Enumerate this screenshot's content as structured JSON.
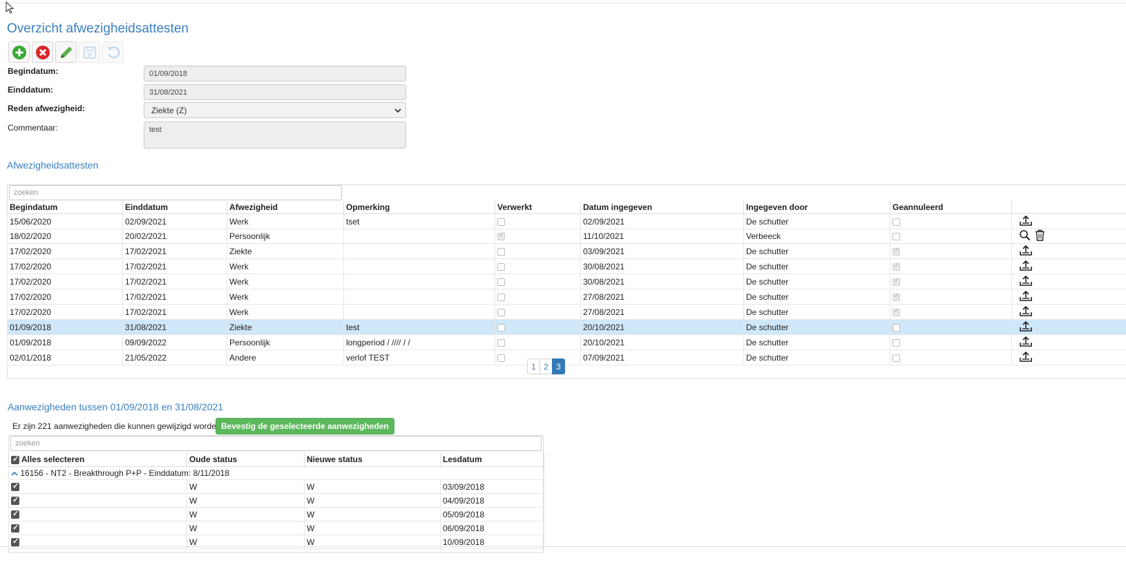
{
  "page": {
    "title": "Overzicht afwezigheidsattesten"
  },
  "toolbar": {
    "buttons": [
      "add-icon",
      "delete-icon",
      "edit-icon",
      "save-icon",
      "undo-icon"
    ]
  },
  "form": {
    "begindatum_label": "Begindatum:",
    "begindatum_value": "01/09/2018",
    "einddatum_label": "Einddatum:",
    "einddatum_value": "31/08/2021",
    "reden_label": "Reden afwezigheid:",
    "reden_value": "Ziekte (Z)",
    "commentaar_label": "Commentaar:",
    "commentaar_value": "test"
  },
  "attesten": {
    "heading": "Afwezigheidsattesten",
    "search_placeholder": "zoeken",
    "columns": [
      "Begindatum",
      "Einddatum",
      "Afwezigheid",
      "Opmerking",
      "Verwerkt",
      "Datum ingegeven",
      "Ingegeven door",
      "Geannuleerd"
    ],
    "rows": [
      {
        "begin": "15/06/2020",
        "eind": "02/09/2021",
        "afw": "Werk",
        "opm": "tset",
        "verwerkt": false,
        "datum": "02/09/2021",
        "door": "De schutter",
        "geannuleerd": false,
        "actions": [
          "upload-icon"
        ]
      },
      {
        "begin": "18/02/2020",
        "eind": "20/02/2021",
        "afw": "Persoonlijk",
        "opm": "",
        "verwerkt": true,
        "datum": "11/10/2021",
        "door": "Verbeeck",
        "geannuleerd": false,
        "actions": [
          "search-icon",
          "trash-icon"
        ]
      },
      {
        "begin": "17/02/2020",
        "eind": "17/02/2021",
        "afw": "Ziekte",
        "opm": "",
        "verwerkt": false,
        "datum": "03/09/2021",
        "door": "De schutter",
        "geannuleerd": true,
        "actions": [
          "upload-icon"
        ]
      },
      {
        "begin": "17/02/2020",
        "eind": "17/02/2021",
        "afw": "Werk",
        "opm": "",
        "verwerkt": false,
        "datum": "30/08/2021",
        "door": "De schutter",
        "geannuleerd": true,
        "actions": [
          "upload-icon"
        ]
      },
      {
        "begin": "17/02/2020",
        "eind": "17/02/2021",
        "afw": "Werk",
        "opm": "",
        "verwerkt": false,
        "datum": "30/08/2021",
        "door": "De schutter",
        "geannuleerd": true,
        "actions": [
          "upload-icon"
        ]
      },
      {
        "begin": "17/02/2020",
        "eind": "17/02/2021",
        "afw": "Werk",
        "opm": "",
        "verwerkt": false,
        "datum": "27/08/2021",
        "door": "De schutter",
        "geannuleerd": true,
        "actions": [
          "upload-icon"
        ]
      },
      {
        "begin": "17/02/2020",
        "eind": "17/02/2021",
        "afw": "Werk",
        "opm": "",
        "verwerkt": false,
        "datum": "27/08/2021",
        "door": "De schutter",
        "geannuleerd": true,
        "actions": [
          "upload-icon"
        ]
      },
      {
        "begin": "01/09/2018",
        "eind": "31/08/2021",
        "afw": "Ziekte",
        "opm": "test",
        "verwerkt": false,
        "datum": "20/10/2021",
        "door": "De schutter",
        "geannuleerd": false,
        "actions": [
          "upload-icon"
        ],
        "selected": true
      },
      {
        "begin": "01/09/2018",
        "eind": "09/09/2022",
        "afw": "Persoonlijk",
        "opm": "longperiod / //// / /",
        "verwerkt": false,
        "datum": "20/10/2021",
        "door": "De schutter",
        "geannuleerd": false,
        "actions": [
          "upload-icon"
        ]
      },
      {
        "begin": "02/01/2018",
        "eind": "21/05/2022",
        "afw": "Andere",
        "opm": "verlof TEST",
        "verwerkt": false,
        "datum": "07/09/2021",
        "door": "De schutter",
        "geannuleerd": false,
        "actions": [
          "upload-icon"
        ]
      }
    ],
    "pagination": {
      "pages": [
        "1",
        "2",
        "3"
      ],
      "current": "3"
    }
  },
  "aanwezigheden": {
    "heading": "Aanwezigheden tussen 01/09/2018 en 31/08/2021",
    "info": "Er zijn 221 aanwezigheden die kunnen gewijzigd worden",
    "confirm_button": "Bevestig de geselecteerde aanwezigheden",
    "search_placeholder": "zoeken",
    "columns": [
      "Alles selecteren",
      "Oude status",
      "Nieuwe status",
      "Lesdatum"
    ],
    "group_label": "16156 - NT2 - Breakthrough P+P - Einddatum: 8/11/2018",
    "rows": [
      {
        "oud": "W",
        "nieuw": "W",
        "datum": "03/09/2018"
      },
      {
        "oud": "W",
        "nieuw": "W",
        "datum": "04/09/2018"
      },
      {
        "oud": "W",
        "nieuw": "W",
        "datum": "05/09/2018"
      },
      {
        "oud": "W",
        "nieuw": "W",
        "datum": "06/09/2018"
      },
      {
        "oud": "W",
        "nieuw": "W",
        "datum": "10/09/2018"
      }
    ]
  }
}
